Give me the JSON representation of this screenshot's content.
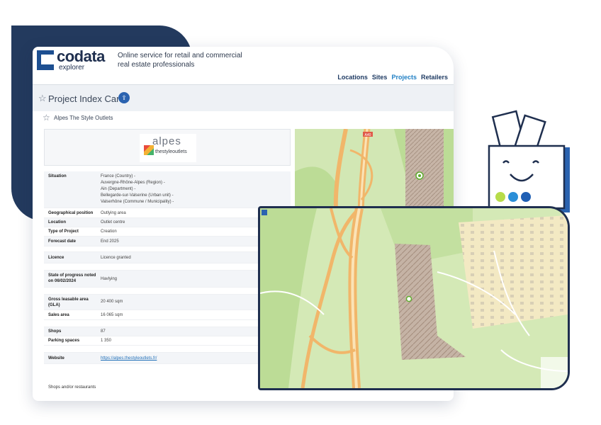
{
  "logo": {
    "name": "codata",
    "sub": "explorer"
  },
  "tagline": "Online service for retail and commercial real estate professionals",
  "nav": [
    {
      "label": "Locations",
      "active": false
    },
    {
      "label": "Sites",
      "active": false
    },
    {
      "label": "Projects",
      "active": true
    },
    {
      "label": "Retailers",
      "active": false
    }
  ],
  "card": {
    "title": "Project Index Card",
    "project_name": "Alpes The Style Outlets"
  },
  "project_logo": {
    "word": "alpes",
    "sub": "thestyleoutlets"
  },
  "situation": {
    "label": "Situation",
    "lines": [
      "France (Country) - ",
      "Auvergne-Rhône-Alpes (Region) - ",
      "Ain (Department) - ",
      "Bellegarde-sur-Valserine (Urban unit) - ",
      "Valserhône (Commune / Municipality) - "
    ]
  },
  "rows": [
    {
      "label": "Geographical position",
      "value": "Outlying area"
    },
    {
      "label": "Location",
      "value": "Outlet centre"
    },
    {
      "label": "Type of Project",
      "value": "Creation"
    },
    {
      "label": "Forecast date",
      "value": "End 2025"
    },
    {
      "label": "Licence",
      "value": "Licence granted"
    },
    {
      "label": "State of progress noted on 06/02/2024",
      "value": "Havlying"
    },
    {
      "label": "Gross leasable area (GLA)",
      "value": "20 400 sqm"
    },
    {
      "label": "Sales area",
      "value": "16 065 sqm"
    },
    {
      "label": "Shops",
      "value": "87"
    },
    {
      "label": "Parking spaces",
      "value": "1 350"
    },
    {
      "label": "Website",
      "value": "https://alpes.thestyleoutlets.fr/"
    }
  ],
  "tail_text": "Shops and/or restaurants",
  "road_label": "A40",
  "colors": {
    "navy": "#233a5e",
    "accent": "#1f7fc4",
    "map_green": "#cfe6b0",
    "road": "#f1b66a"
  }
}
